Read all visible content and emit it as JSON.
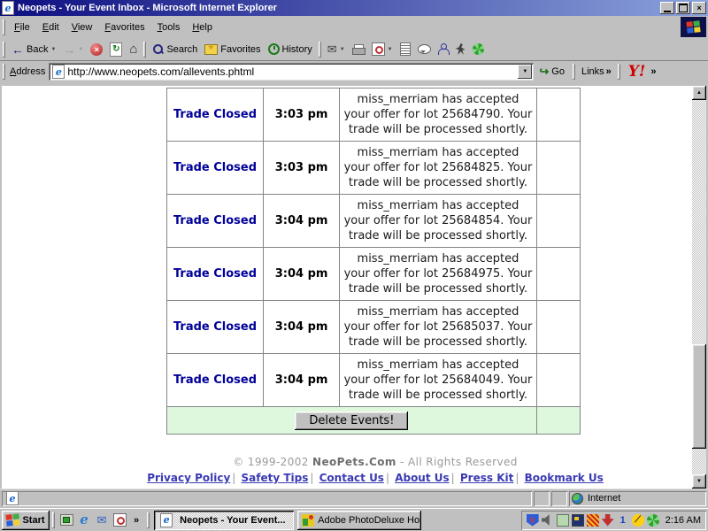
{
  "window": {
    "title": "Neopets - Your Event Inbox - Microsoft Internet Explorer"
  },
  "menubar": {
    "items": [
      "File",
      "Edit",
      "View",
      "Favorites",
      "Tools",
      "Help"
    ]
  },
  "toolbar": {
    "back_label": "Back",
    "search_label": "Search",
    "favorites_label": "Favorites",
    "history_label": "History"
  },
  "addressbar": {
    "label": "Address",
    "url": "http://www.neopets.com/allevents.phtml",
    "go_label": "Go",
    "links_label": "Links",
    "yahoo_label": "Y!"
  },
  "icons": {
    "back_arrow": "←",
    "forward_arrow": "→",
    "dropdown": "▼",
    "scroll_up": "▲",
    "scroll_down": "▼",
    "stop": "×",
    "refresh": "↻",
    "home": "⌂",
    "mail": "✉",
    "close": "×",
    "go_arrow": "↪",
    "chevron": "»",
    "envelope": "✉",
    "icq_one": "1",
    "aim_glyph": "⟋",
    "shield_v": "V"
  },
  "events": {
    "rows": [
      {
        "type": "Trade Closed",
        "time": "3:03 pm",
        "message": "miss_merriam has accepted your offer for lot 25684790. Your trade will be processed shortly."
      },
      {
        "type": "Trade Closed",
        "time": "3:03 pm",
        "message": "miss_merriam has accepted your offer for lot 25684825. Your trade will be processed shortly."
      },
      {
        "type": "Trade Closed",
        "time": "3:04 pm",
        "message": "miss_merriam has accepted your offer for lot 25684854. Your trade will be processed shortly."
      },
      {
        "type": "Trade Closed",
        "time": "3:04 pm",
        "message": "miss_merriam has accepted your offer for lot 25684975. Your trade will be processed shortly."
      },
      {
        "type": "Trade Closed",
        "time": "3:04 pm",
        "message": "miss_merriam has accepted your offer for lot 25685037. Your trade will be processed shortly."
      },
      {
        "type": "Trade Closed",
        "time": "3:04 pm",
        "message": "miss_merriam has accepted your offer for lot 25684049. Your trade will be processed shortly."
      }
    ],
    "delete_button": "Delete Events!"
  },
  "footer": {
    "copyright_prefix": "© 1999-2002",
    "site_link": "NeoPets.Com",
    "copyright_suffix": "- All Rights Reserved",
    "separator": "|",
    "links": [
      "Privacy Policy",
      "Safety Tips",
      "Contact Us",
      "About Us",
      "Press Kit",
      "Bookmark Us"
    ]
  },
  "statusbar": {
    "zone_label": "Internet"
  },
  "taskbar": {
    "start_label": "Start",
    "chevron": "»",
    "tasks": [
      {
        "label": "Neopets - Your Event..."
      },
      {
        "label": "Adobe PhotoDeluxe Home..."
      }
    ],
    "clock": "2:16 AM"
  },
  "colors": {
    "titlebar_gradient_start": "#0d0e80",
    "titlebar_gradient_end": "#8ba2dc",
    "chrome_gray": "#c0c0c0",
    "event_type_blue": "#000099",
    "green_row": "#ddf8dd",
    "footer_link_blue": "#3a3ab4",
    "yahoo_red": "#d00000"
  }
}
